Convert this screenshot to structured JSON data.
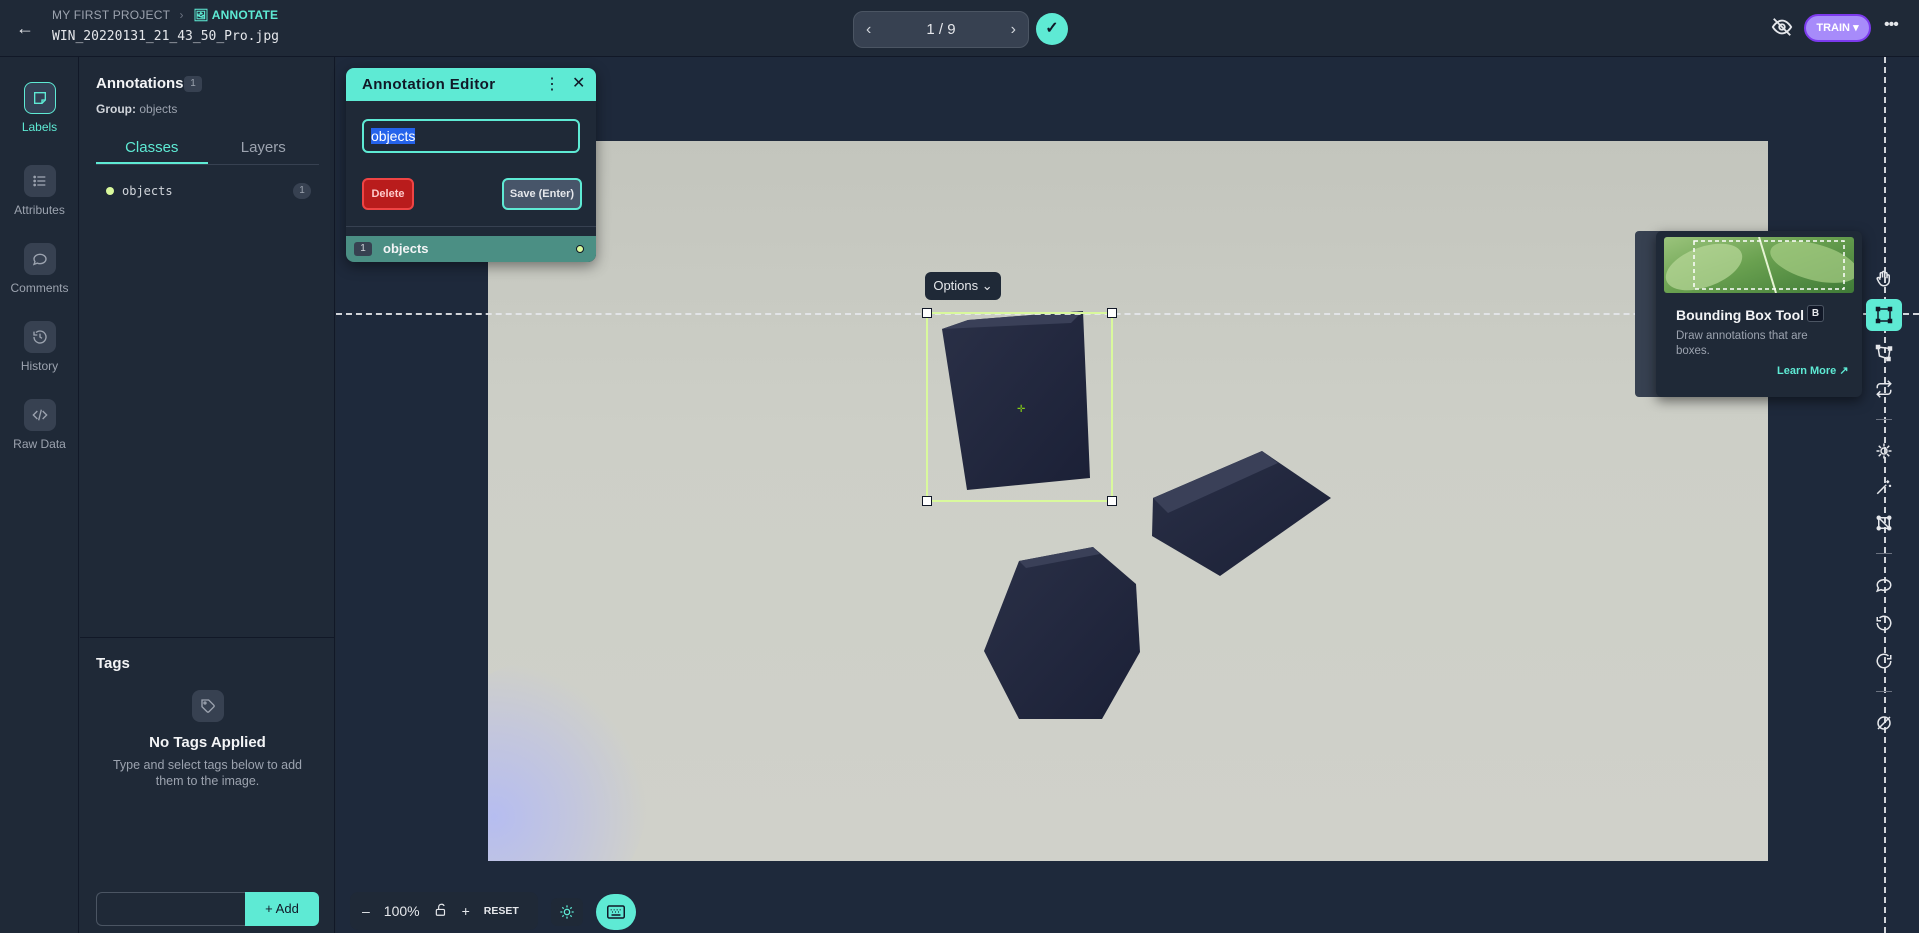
{
  "header": {
    "project": "MY FIRST PROJECT",
    "section": "ANNOTATE",
    "filename": "WIN_20220131_21_43_50_Pro.jpg",
    "pager": "1 / 9",
    "train_label": "TRAIN"
  },
  "rail": {
    "items": [
      {
        "label": "Labels",
        "icon": "labels-icon"
      },
      {
        "label": "Attributes",
        "icon": "list-icon"
      },
      {
        "label": "Comments",
        "icon": "comment-icon"
      },
      {
        "label": "History",
        "icon": "history-icon"
      },
      {
        "label": "Raw Data",
        "icon": "code-icon"
      }
    ]
  },
  "panel": {
    "title": "Annotations",
    "count": "1",
    "group_label": "Group:",
    "group_value": "objects",
    "tabs": [
      "Classes",
      "Layers"
    ],
    "classes": [
      {
        "name": "objects",
        "count": "1",
        "color": "#d9f99d"
      }
    ],
    "tags_title": "Tags",
    "no_tags_title": "No Tags Applied",
    "no_tags_desc": "Type and select tags below to add them to the image.",
    "add_label": "Add"
  },
  "editor": {
    "title": "Annotation Editor",
    "input_value": "objects",
    "delete_label": "Delete",
    "save_label": "Save (Enter)",
    "row_index": "1",
    "row_name": "objects"
  },
  "canvas": {
    "options_label": "Options"
  },
  "tooltip": {
    "title": "Bounding Box Tool",
    "key": "B",
    "desc": "Draw annotations that are boxes.",
    "learn_more": "Learn More ↗"
  },
  "bottom": {
    "zoom": "100%",
    "reset": "RESET"
  },
  "colors": {
    "accent": "#5eead4",
    "train": "#a78bfa",
    "bbox": "#d9f99d",
    "delete": "#b91c1c"
  }
}
